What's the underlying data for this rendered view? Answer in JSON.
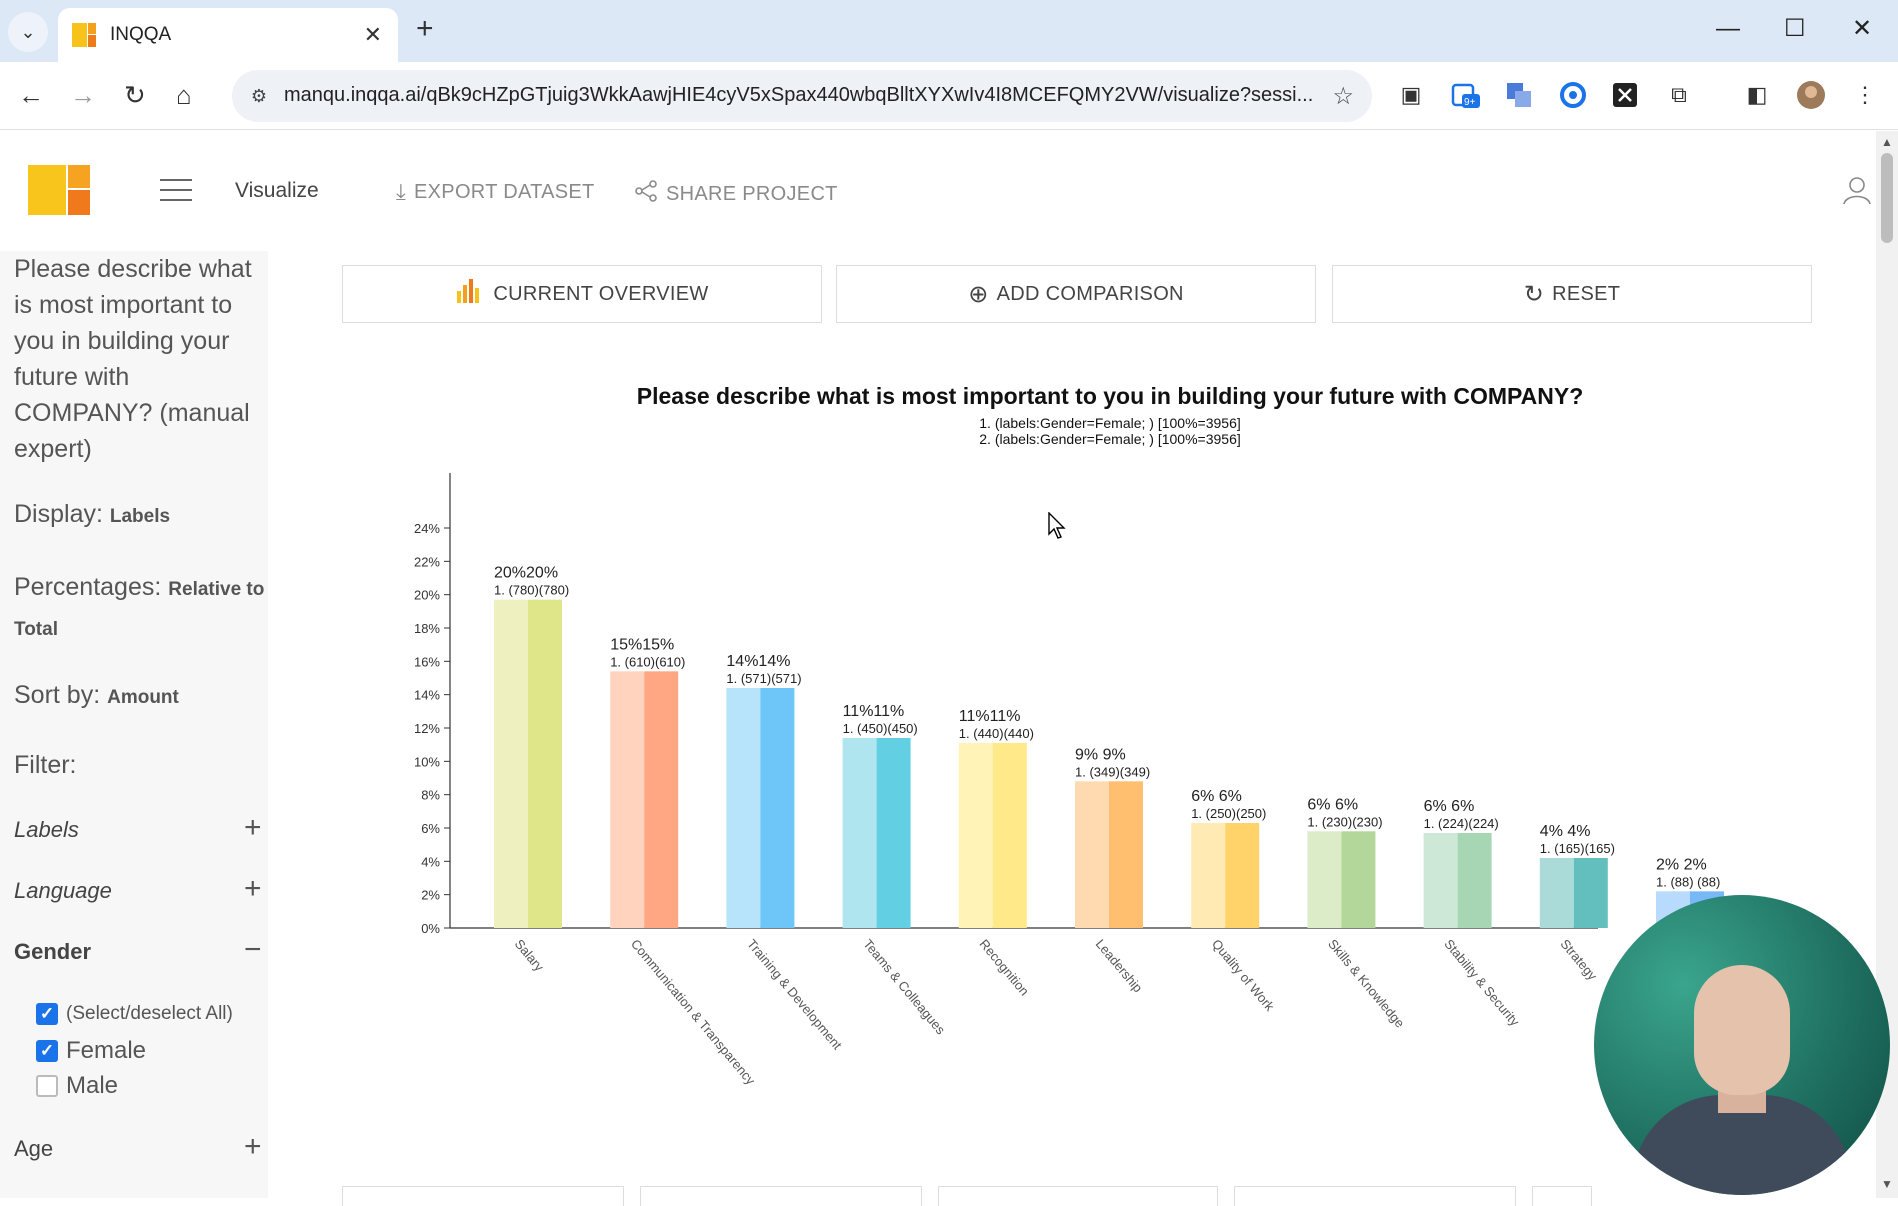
{
  "browser": {
    "tab_title": "INQQA",
    "url": "manqu.inqqa.ai/qBk9cHZpGTjuig3WkkAawjHIE4cyV5xSpax440wbqBlltXYXwIv4I8MCEFQMY2VW/visualize?sessi...",
    "extension_badge": "9+"
  },
  "header": {
    "nav_title": "Visualize",
    "export_label": "EXPORT DATASET",
    "share_label": "SHARE PROJECT"
  },
  "sidebar": {
    "question": "Please describe what is most important to you in building your future with COMPANY? (manual expert)",
    "display_label": "Display:",
    "display_value": "Labels",
    "percentages_label": "Percentages:",
    "percentages_value_1": "Relative to",
    "percentages_value_2": "Total",
    "sort_label": "Sort by:",
    "sort_value": "Amount",
    "filter_label": "Filter:",
    "filters": {
      "labels": "Labels",
      "language": "Language",
      "gender": "Gender",
      "age": "Age"
    },
    "gender_options": {
      "all": "(Select/deselect All)",
      "female": "Female",
      "male": "Male"
    }
  },
  "main": {
    "current_overview": "CURRENT OVERVIEW",
    "add_comparison": "ADD COMPARISON",
    "reset": "RESET"
  },
  "chart_data": {
    "type": "bar",
    "title": "Please describe what is most important to you in building your future with COMPANY?",
    "subtitle_lines": [
      "1. (labels:Gender=Female; ) [100%=3956]",
      "2. (labels:Gender=Female; ) [100%=3956]"
    ],
    "categories": [
      "Salary",
      "Communication & Transparency",
      "Training & Development",
      "Teams & Colleagues",
      "Recognition",
      "Leadership",
      "Quality of Work",
      "Skills & Knowledge",
      "Stability & Security",
      "Strategy",
      ""
    ],
    "series": [
      {
        "name": "1. (labels:Gender=Female; ) [100%=3956]",
        "values": [
          780,
          610,
          571,
          450,
          440,
          349,
          250,
          230,
          224,
          165,
          88
        ]
      },
      {
        "name": "2. (labels:Gender=Female; ) [100%=3956]",
        "values": [
          780,
          610,
          571,
          450,
          440,
          349,
          250,
          230,
          224,
          165,
          88
        ]
      }
    ],
    "percent_labels": [
      "20%20%",
      "15%15%",
      "14%14%",
      "11%11%",
      "11%11%",
      "9% 9%",
      "6% 6%",
      "6% 6%",
      "6% 6%",
      "4% 4%",
      "2% 2%"
    ],
    "count_labels": [
      "1. (780)(780)",
      "1. (610)(610)",
      "1. (571)(571)",
      "1. (450)(450)",
      "1. (440)(440)",
      "1. (349)(349)",
      "1. (250)(250)",
      "1. (230)(230)",
      "1. (224)(224)",
      "1. (165)(165)",
      "1. (88) (88)"
    ],
    "percent_values": [
      19.7,
      15.4,
      14.4,
      11.4,
      11.1,
      8.8,
      6.3,
      5.8,
      5.7,
      4.2,
      2.2
    ],
    "colors_light": [
      "#eef0c0",
      "#ffd3be",
      "#b8e4fb",
      "#aee5ef",
      "#fff3b8",
      "#ffd9b0",
      "#ffeab4",
      "#dcecc8",
      "#cde8d6",
      "#aadbd9",
      "#b8dafc"
    ],
    "colors_dark": [
      "#dfe68a",
      "#ffa783",
      "#6ec6f8",
      "#62cfe2",
      "#ffe989",
      "#ffbf6e",
      "#ffd36a",
      "#b3d79a",
      "#a7d6b4",
      "#63bfbd",
      "#78b8f6"
    ],
    "y_ticks": [
      "0%",
      "2%",
      "4%",
      "6%",
      "8%",
      "10%",
      "12%",
      "14%",
      "16%",
      "18%",
      "20%",
      "22%",
      "24%"
    ],
    "ylim": [
      0,
      25
    ],
    "grid": false
  }
}
